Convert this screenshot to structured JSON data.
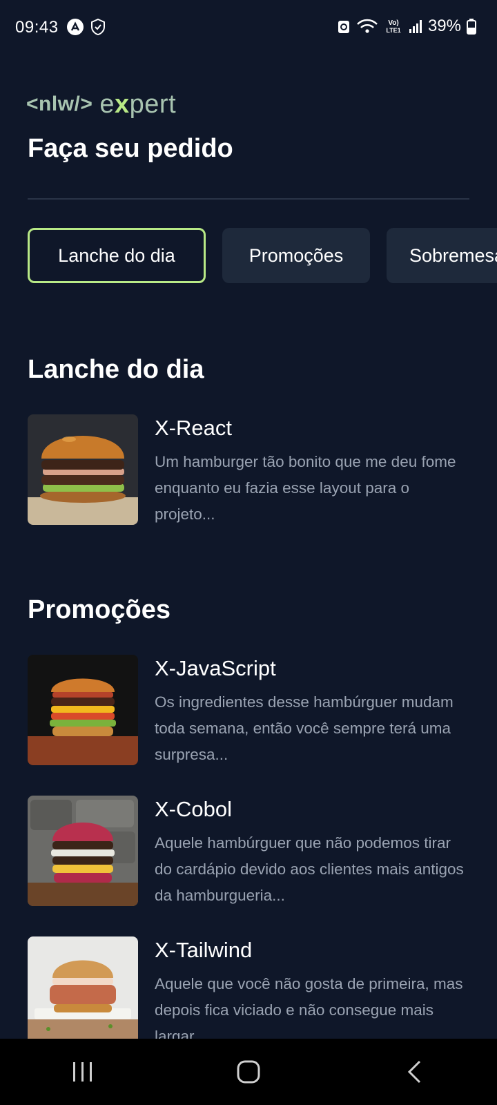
{
  "status_bar": {
    "time": "09:43",
    "network_label": "Vo) LTE1",
    "battery": "39%"
  },
  "header": {
    "logo_part1": "<nlw/>",
    "logo_part2_a": "e",
    "logo_part2_x": "x",
    "logo_part2_b": "pert",
    "title": "Faça seu pedido"
  },
  "tabs": [
    {
      "label": "Lanche do dia",
      "active": true
    },
    {
      "label": "Promoções",
      "active": false
    },
    {
      "label": "Sobremesas",
      "active": false
    }
  ],
  "sections": [
    {
      "title": "Lanche do dia",
      "products": [
        {
          "name": "X-React",
          "description": "Um hamburger tão bonito que me deu fome enquanto eu fazia esse layout para o projeto..."
        }
      ]
    },
    {
      "title": "Promoções",
      "products": [
        {
          "name": "X-JavaScript",
          "description": "Os ingredientes desse hambúrguer mudam toda semana, então você sempre terá uma surpresa..."
        },
        {
          "name": "X-Cobol",
          "description": "Aquele hambúrguer que não podemos tirar do cardápio devido aos clientes mais antigos da hamburgueria..."
        },
        {
          "name": "X-Tailwind",
          "description": "Aquele que você não gosta de primeira, mas depois fica viciado e não consegue mais largar..."
        }
      ]
    }
  ],
  "colors": {
    "background": "#0f1729",
    "accent": "#b8e986",
    "tab_bg": "#1e293b",
    "muted_text": "#9aa3b2"
  }
}
